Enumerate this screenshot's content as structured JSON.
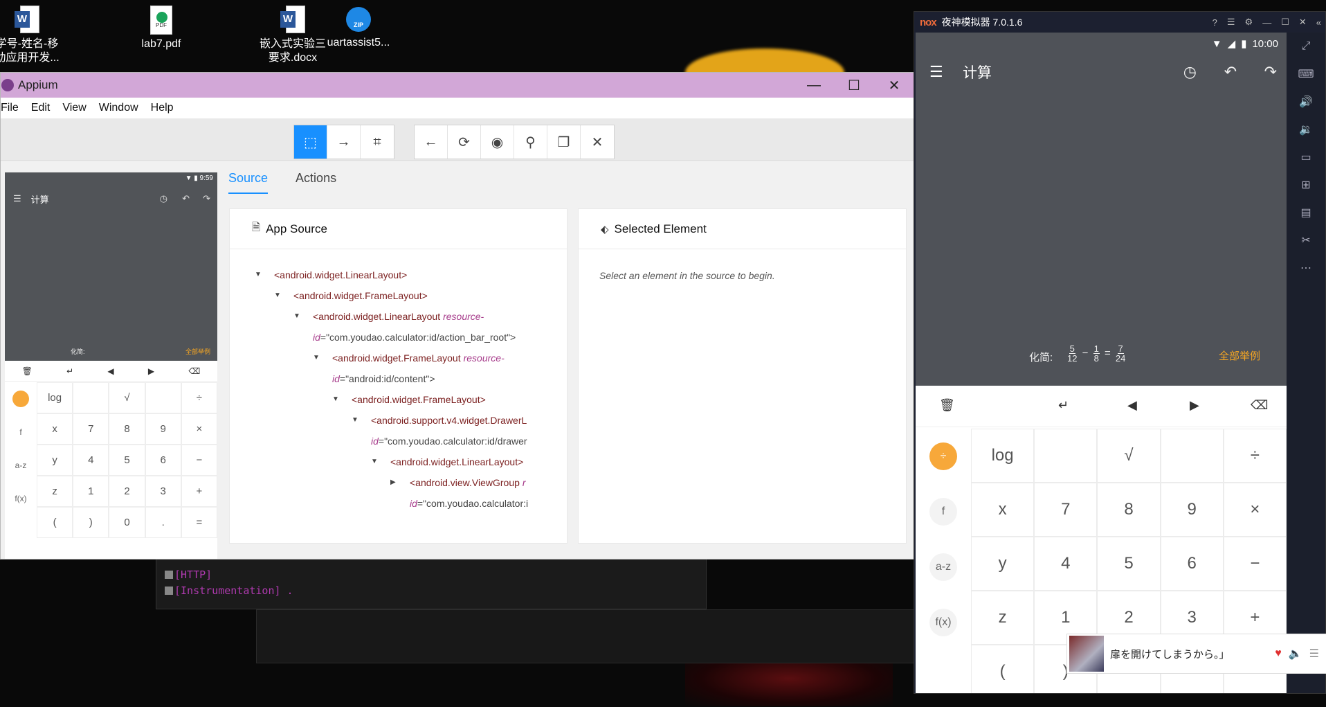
{
  "desktop": {
    "icons": [
      {
        "label": "学号-姓名-移\n动应用开发...",
        "type": "word"
      },
      {
        "label": "lab7.pdf",
        "type": "pdf"
      },
      {
        "label": "嵌入式实验三\n要求.docx",
        "type": "word"
      },
      {
        "label": "uartassist5...",
        "type": "zip"
      }
    ]
  },
  "terminal": {
    "lines": [
      "[HTTP]",
      "[Instrumentation] ."
    ]
  },
  "appium": {
    "title": "Appium",
    "menu": [
      "File",
      "Edit",
      "View",
      "Window",
      "Help"
    ],
    "tabs": [
      {
        "label": "Source"
      },
      {
        "label": "Actions"
      }
    ],
    "app_source": {
      "title": "App Source",
      "nodes": [
        {
          "tag": "<android.widget.LinearLayout>",
          "attr": "",
          "val": ""
        },
        {
          "tag": "<android.widget.FrameLayout>",
          "attr": "",
          "val": ""
        },
        {
          "tag": "<android.widget.LinearLayout",
          "attr": "resource-",
          "val": "",
          "cont_attr": "id",
          "cont_val": "=\"com.youdao.calculator:id/action_bar_root\">"
        },
        {
          "tag": "<android.widget.FrameLayout",
          "attr": "resource-",
          "val": "",
          "cont_attr": "id",
          "cont_val": "=\"android:id/content\">"
        },
        {
          "tag": "<android.widget.FrameLayout>",
          "attr": "",
          "val": ""
        },
        {
          "tag": "<android.support.v4.widget.DrawerL",
          "attr": "",
          "val": "",
          "cont_attr": "id",
          "cont_val": "=\"com.youdao.calculator:id/drawer"
        },
        {
          "tag": "<android.widget.LinearLayout>",
          "attr": "",
          "val": ""
        },
        {
          "tag": "<android.view.ViewGroup",
          "attr": "r",
          "val": "",
          "cont_attr": "id",
          "cont_val": "=\"com.youdao.calculator:i"
        }
      ]
    },
    "selected_element": {
      "title": "Selected Element",
      "placeholder": "Select an element in the source to begin."
    },
    "mini": {
      "time": "9:59",
      "title": "计算",
      "formula_prefix": "化简:",
      "example": "全部举例",
      "side": [
        "",
        "f",
        "a-z",
        "f(x)"
      ],
      "keys": [
        "log",
        "",
        "√",
        "",
        "÷",
        "x",
        "7",
        "8",
        "9",
        "×",
        "y",
        "4",
        "5",
        "6",
        "−",
        "z",
        "1",
        "2",
        "3",
        "+",
        "(",
        ")",
        "0",
        ".",
        "="
      ]
    }
  },
  "nox": {
    "brand": "nox",
    "title": "夜神模拟器 7.0.1.6",
    "time": "10:00",
    "calc_title": "计算",
    "formula_prefix": "化简:",
    "formula": {
      "a": [
        "5",
        "12"
      ],
      "b": [
        "1",
        "8"
      ],
      "r": [
        "7",
        "24"
      ]
    },
    "example": "全部举例",
    "side": [
      "÷×\n+−",
      "f",
      "a-z",
      "f(x)"
    ],
    "keys": [
      "log",
      "",
      "√",
      "",
      "÷",
      "x",
      "7",
      "8",
      "9",
      "×",
      "y",
      "4",
      "5",
      "6",
      "−",
      "z",
      "1",
      "2",
      "3",
      "+",
      "(",
      ")",
      "",
      "",
      ""
    ]
  },
  "notification": {
    "text": "扉を開けてしまうから。」"
  }
}
